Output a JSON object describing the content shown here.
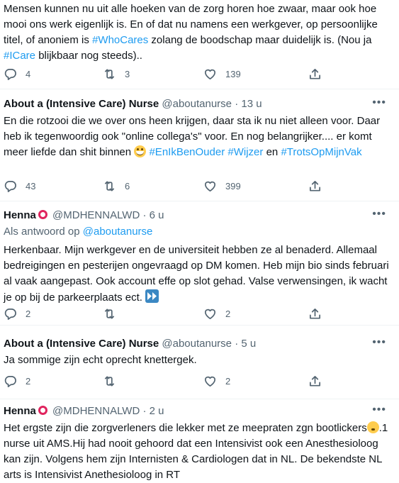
{
  "tweets": [
    {
      "text_parts": [
        "Mensen kunnen nu uit alle hoeken van de zorg horen hoe zwaar, maar ook hoe mooi ons werk eigenlijk is. En of dat nu namens een werkgever, op persoonlijke titel, of anoniem is ",
        "#WhoCares",
        " zolang de boodschap maar duidelijk is. (Nou ja ",
        "#ICare",
        " blijkbaar nog steeds).."
      ],
      "replies": "4",
      "retweets": "3",
      "likes": "139"
    },
    {
      "name": "About a (Intensive Care) Nurse",
      "handle": "@aboutanurse",
      "sep": "·",
      "time": "13 u",
      "more": "•••",
      "text_parts": [
        "En die rotzooi die we over ons heen krijgen, daar sta ik nu niet alleen voor. Daar heb ik tegenwoordig ook \"online collega's\" voor. En nog belangrijker.... er komt meer liefde dan shit binnen ",
        " ",
        "#EnIkBenOuder",
        " ",
        "#Wijzer",
        " en ",
        "#TrotsOpMijnVak"
      ],
      "replies": "43",
      "retweets": "6",
      "likes": "399"
    },
    {
      "name": "Henna",
      "handle": "@MDHENNALWD",
      "sep": "·",
      "time": "6 u",
      "more": "•••",
      "reply_prefix": "Als antwoord op",
      "reply_handle": "@aboutanurse",
      "text": "Herkenbaar. Mijn werkgever en de universiteit hebben ze al benaderd. Allemaal bedreigingen en pesterijen ongevraagd op DM komen. Heb mijn bio sinds februari al vaak aangepast. Ook account effe op slot gehad. Valse verwensingen, ik wacht je op bij de parkeerplaats ect.",
      "replies": "2",
      "retweets": "",
      "likes": "2"
    },
    {
      "name": "About a (Intensive Care) Nurse",
      "handle": "@aboutanurse",
      "sep": "·",
      "time": "5 u",
      "more": "•••",
      "text": "Ja sommige zijn echt oprecht knettergek.",
      "replies": "2",
      "retweets": "",
      "likes": "2"
    },
    {
      "name": "Henna",
      "handle": "@MDHENNALWD",
      "sep": "·",
      "time": "2 u",
      "more": "•••",
      "text_a": "Het ergste zijn die zorgverleners die lekker met ze meepraten zgn bootlickers",
      "text_b": ".1 nurse uit AMS.Hij had nooit gehoord dat een Intensivist ook een Anesthesioloog kan zijn. Volgens hem zijn Internisten & Cardiologen dat in NL. De bekendste NL arts is Intensivist Anethesioloog in RT"
    }
  ],
  "colors": {
    "link": "#1d9bf0",
    "muted": "#536471",
    "text": "#0f1419",
    "divider": "#eff3f4"
  },
  "icons": {
    "reply": "reply-icon",
    "retweet": "retweet-icon",
    "like": "heart-icon",
    "share": "share-icon",
    "more": "more-icon"
  }
}
